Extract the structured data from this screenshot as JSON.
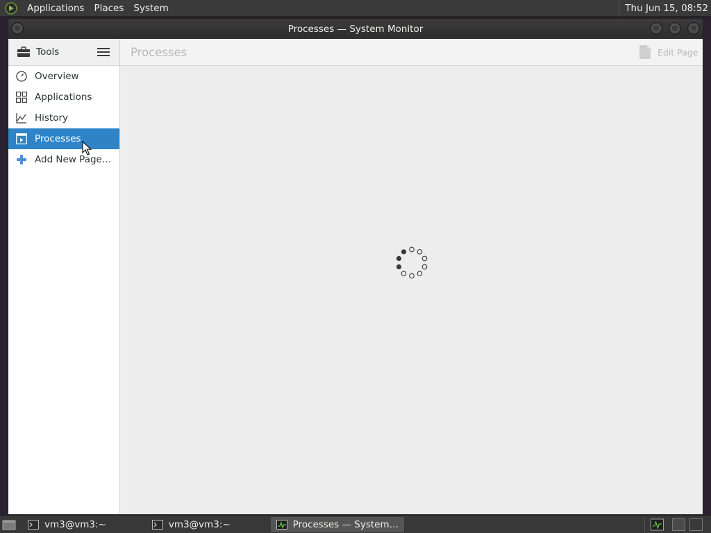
{
  "top_panel": {
    "menus": [
      "Applications",
      "Places",
      "System"
    ],
    "clock": "Thu Jun 15, 08:52"
  },
  "window": {
    "title": "Processes — System Monitor"
  },
  "sidebar": {
    "header_label": "Tools",
    "items": [
      {
        "label": "Overview",
        "icon": "gauge-icon"
      },
      {
        "label": "Applications",
        "icon": "grid-icon"
      },
      {
        "label": "History",
        "icon": "chart-icon"
      },
      {
        "label": "Processes",
        "icon": "window-play-icon",
        "active": true
      },
      {
        "label": "Add New Page…",
        "icon": "plus-icon"
      }
    ]
  },
  "main": {
    "page_title": "Processes",
    "edit_label": "Edit Page",
    "state": "loading"
  },
  "taskbar": {
    "tasks": [
      {
        "label": "vm3@vm3:~",
        "icon": "terminal-icon"
      },
      {
        "label": "vm3@vm3:~",
        "icon": "terminal-icon"
      },
      {
        "label": "Processes — System…",
        "icon": "system-monitor-icon",
        "active": true
      }
    ]
  },
  "colors": {
    "accent": "#2f84c7",
    "panel": "#3a3a3a",
    "background": "#ededed"
  }
}
